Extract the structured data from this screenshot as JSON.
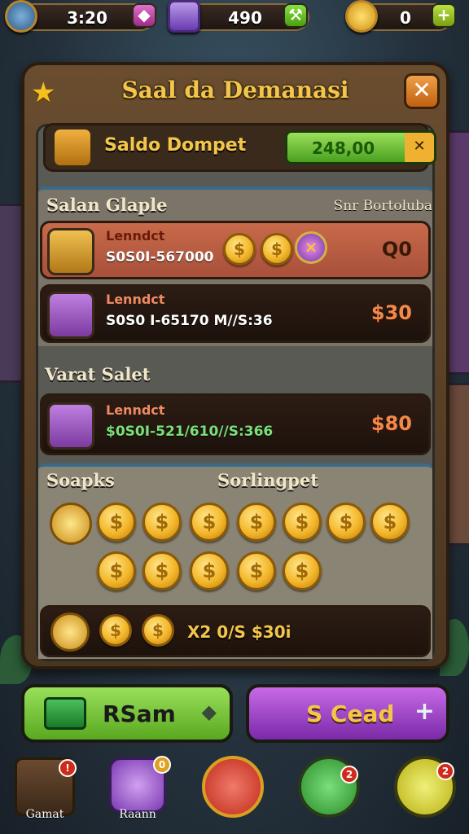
{
  "topbar": {
    "timer": "3:20",
    "gems": "490",
    "hints": "0"
  },
  "panel": {
    "title": "Saal da Demanasi"
  },
  "wallet": {
    "label": "Saldo Dompet",
    "value": "248,00"
  },
  "section1": {
    "title": "Salan Glaple",
    "right_label": "Snr Bortoluba",
    "rows": [
      {
        "title": "Lenndct",
        "sub": "S0S0I-567000",
        "price": "Q0"
      },
      {
        "title": "Lenndct",
        "sub": "S0S0 I-65170 M//S:36",
        "price": "$30"
      }
    ]
  },
  "section2": {
    "title": "Varat Salet",
    "rows": [
      {
        "title": "Lenndct",
        "sub": "$0S0I-521/610//S:366",
        "price": "$80"
      }
    ]
  },
  "section3": {
    "title_left": "Soapks",
    "title_right": "Sorlingpet",
    "coin_symbol": "$",
    "summary": "X2 0/S $30i"
  },
  "buttons": {
    "left": "RSam",
    "right": "S Cead"
  },
  "nav": [
    {
      "label": "Gamat"
    },
    {
      "label": "Raann"
    }
  ],
  "colors": {
    "green_button": "#6cc02a",
    "purple_button": "#9a3ac8",
    "accent_gold": "#f3c64a"
  }
}
